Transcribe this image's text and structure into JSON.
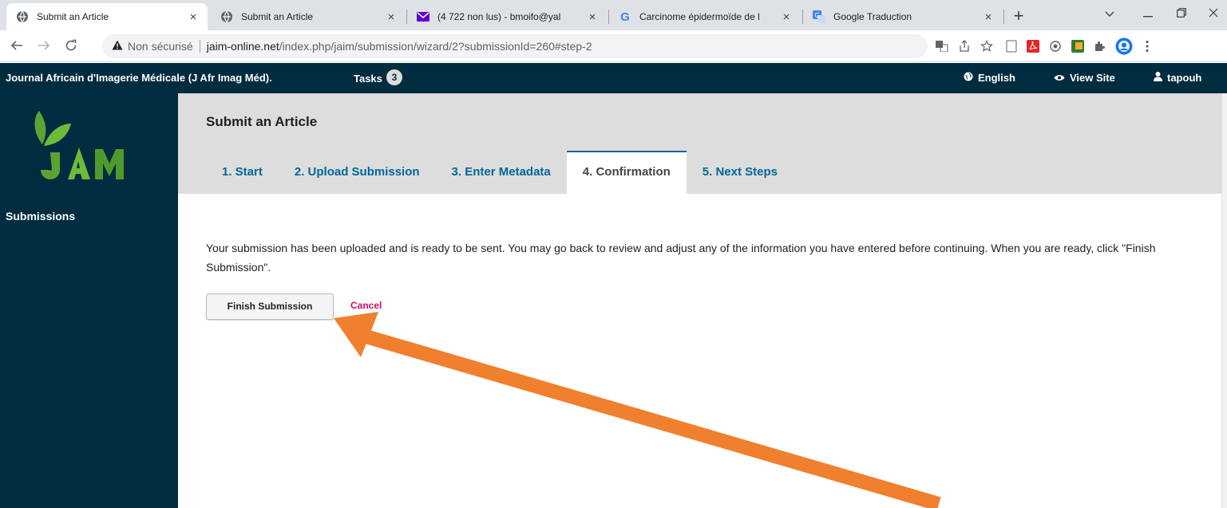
{
  "browser": {
    "tabs": [
      {
        "title": "Submit an Article",
        "icon": "globe-icon",
        "active": true
      },
      {
        "title": "Submit an Article",
        "icon": "globe-icon",
        "active": false
      },
      {
        "title": "(4 722 non lus) - bmoifo@yal",
        "icon": "mail-icon",
        "active": false
      },
      {
        "title": "Carcinome épidermoïde de l",
        "icon": "google-icon",
        "active": false
      },
      {
        "title": "Google Traduction",
        "icon": "translate-icon",
        "active": false
      }
    ],
    "close_glyph": "×",
    "new_tab_glyph": "+",
    "address": {
      "security_label": "Non sécurisé",
      "host": "jaim-online.net",
      "path": "/index.php/jaim/submission/wizard/2?submissionId=260#step-2"
    }
  },
  "header": {
    "journal_title": "Journal Africain d'Imagerie Médicale (J Afr Imag Méd).",
    "tasks_label": "Tasks",
    "tasks_count": "3",
    "language_label": "English",
    "view_site_label": "View Site",
    "user_label": "tapouh"
  },
  "sidebar": {
    "submissions_label": "Submissions"
  },
  "main": {
    "page_title": "Submit an Article",
    "steps": [
      {
        "label": "1. Start"
      },
      {
        "label": "2. Upload Submission"
      },
      {
        "label": "3. Enter Metadata"
      },
      {
        "label": "4. Confirmation"
      },
      {
        "label": "5. Next Steps"
      }
    ],
    "current_step_index": 3,
    "intro_text": "Your submission has been uploaded and is ready to be sent. You may go back to review and adjust any of the information you have entered before continuing. When you are ready, click \"Finish Submission\".",
    "finish_button_label": "Finish Submission",
    "cancel_label": "Cancel"
  },
  "colors": {
    "header_bg": "#002c40",
    "link_blue": "#006798",
    "cancel_pink": "#d00a6c",
    "logo_green": "#5aa532",
    "annotation_arrow": "#f07f2e"
  }
}
